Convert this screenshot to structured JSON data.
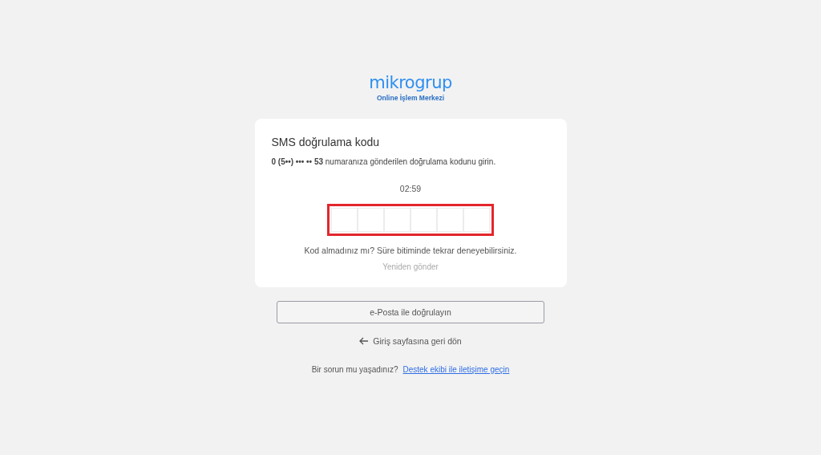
{
  "logo": {
    "name": "mikrogrup",
    "subtitle": "Online İşlem Merkezi"
  },
  "card": {
    "title": "SMS doğrulama kodu",
    "message": "**0 (5••) ••• •• 53** numaranıza gönderilen doğrulama kodunu girin.",
    "timer": "02:59",
    "code_inputs": {
      "highlighted": true,
      "cells": [
        "",
        "",
        "",
        "",
        "",
        ""
      ]
    },
    "hint": "Kod almadınız mı? Süre bitiminde tekrar deneyebilirsiniz.",
    "resend": {
      "label": "Yeniden gönder",
      "disabled": true
    }
  },
  "email_button": "e-Posta ile doğrulayın",
  "back_link": "Giriş sayfasına geri dön",
  "support": {
    "text": "Bir sorun mu yaşadınız?",
    "link": "Destek ekibi ile iletişime geçin"
  }
}
